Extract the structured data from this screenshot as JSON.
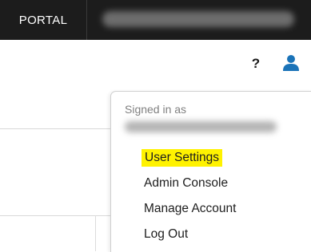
{
  "topbar": {
    "brand": "PORTAL"
  },
  "header_icons": {
    "help": "?",
    "help_icon": "question-icon",
    "user_icon": "user-icon",
    "user_icon_color": "#1a73b8"
  },
  "account_menu": {
    "signed_in_label": "Signed in as",
    "items": [
      {
        "label": "User Settings",
        "highlighted": true,
        "highlight_color": "#fff200"
      },
      {
        "label": "Admin Console"
      },
      {
        "label": "Manage Account"
      },
      {
        "label": "Log Out"
      }
    ]
  }
}
